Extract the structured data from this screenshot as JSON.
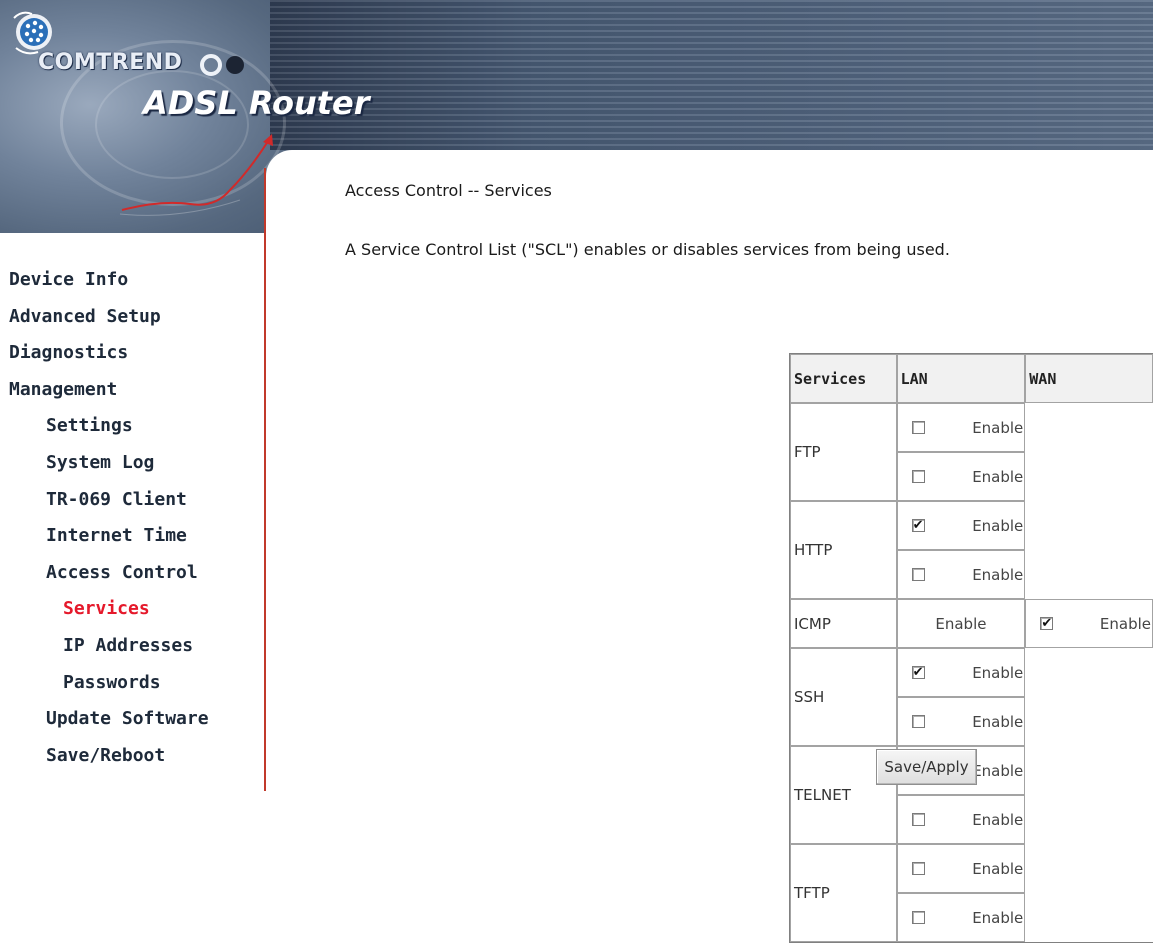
{
  "header": {
    "brand_name": "COMTREND",
    "product_title": "ADSL Router"
  },
  "sidebar": {
    "items": [
      {
        "label": "Device Info",
        "level": 0
      },
      {
        "label": "Advanced Setup",
        "level": 0
      },
      {
        "label": "Diagnostics",
        "level": 0
      },
      {
        "label": "Management",
        "level": 0
      },
      {
        "label": "Settings",
        "level": 1
      },
      {
        "label": "System Log",
        "level": 1
      },
      {
        "label": "TR-069 Client",
        "level": 1
      },
      {
        "label": "Internet Time",
        "level": 1
      },
      {
        "label": "Access Control",
        "level": 1
      },
      {
        "label": "Services",
        "level": 2,
        "active": true
      },
      {
        "label": "IP Addresses",
        "level": 2
      },
      {
        "label": "Passwords",
        "level": 2
      },
      {
        "label": "Update Software",
        "level": 1
      },
      {
        "label": "Save/Reboot",
        "level": 1
      }
    ],
    "active_color": "#e5192b"
  },
  "main": {
    "title": "Access Control -- Services",
    "description": "A Service Control List (\"SCL\") enables or disables services from being used.",
    "table": {
      "headers": [
        "Services",
        "LAN",
        "WAN"
      ],
      "rows": [
        {
          "service": "FTP",
          "lan": {
            "has_checkbox": true,
            "checked": false,
            "label": "Enable"
          },
          "wan": {
            "has_checkbox": true,
            "checked": false,
            "label": "Enable"
          }
        },
        {
          "service": "HTTP",
          "lan": {
            "has_checkbox": true,
            "checked": true,
            "label": "Enable"
          },
          "wan": {
            "has_checkbox": true,
            "checked": false,
            "label": "Enable"
          }
        },
        {
          "service": "ICMP",
          "lan": {
            "has_checkbox": false,
            "checked": false,
            "label": "Enable"
          },
          "wan": {
            "has_checkbox": true,
            "checked": true,
            "label": "Enable"
          }
        },
        {
          "service": "SSH",
          "lan": {
            "has_checkbox": true,
            "checked": true,
            "label": "Enable"
          },
          "wan": {
            "has_checkbox": true,
            "checked": false,
            "label": "Enable"
          }
        },
        {
          "service": "TELNET",
          "lan": {
            "has_checkbox": true,
            "checked": true,
            "label": "Enable"
          },
          "wan": {
            "has_checkbox": true,
            "checked": false,
            "label": "Enable"
          }
        },
        {
          "service": "TFTP",
          "lan": {
            "has_checkbox": true,
            "checked": false,
            "label": "Enable"
          },
          "wan": {
            "has_checkbox": true,
            "checked": false,
            "label": "Enable"
          }
        }
      ]
    },
    "save_label": "Save/Apply"
  }
}
